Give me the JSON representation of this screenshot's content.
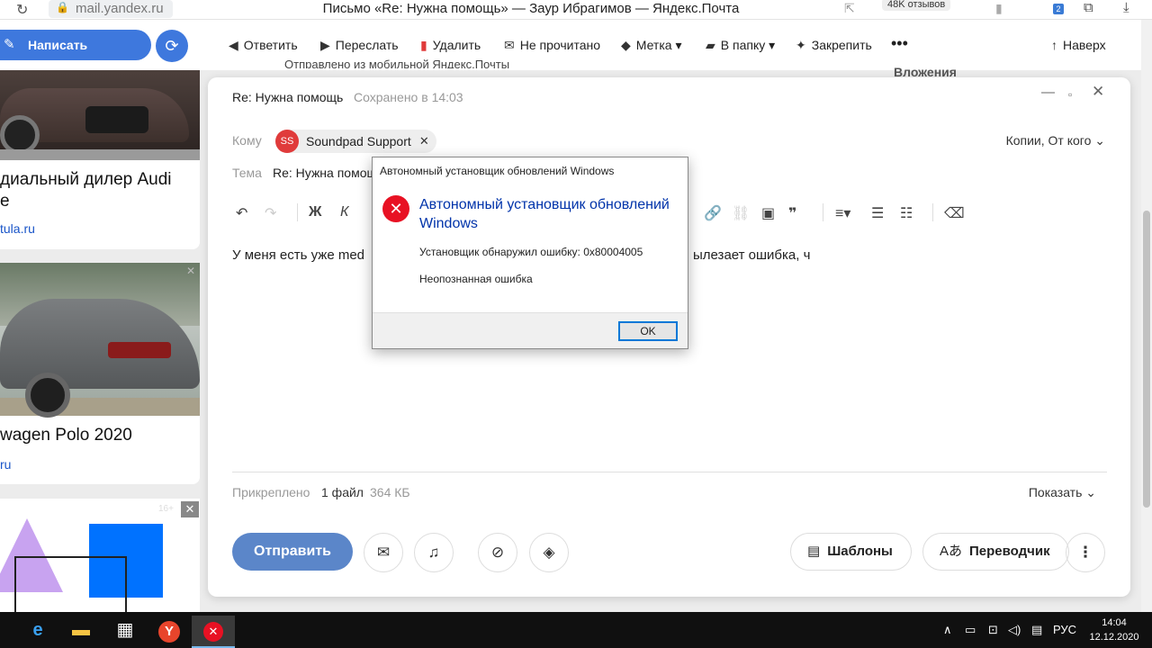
{
  "browser": {
    "url": "mail.yandex.ru",
    "window_title": "Письмо «Re: Нужна помощь» — Заур Ибрагимов — Яндекс.Почта",
    "reviews_badge": "48K отзывов",
    "ext_badge": "2"
  },
  "mailbar": {
    "compose": "Написать",
    "actions": {
      "reply": "Ответить",
      "forward": "Переслать",
      "delete": "Удалить",
      "unread": "Не прочитано",
      "label": "Метка",
      "folder": "В папку",
      "pin": "Закрепить",
      "up": "Наверх"
    }
  },
  "ads": {
    "ad1_title": "диальный дилер Audi",
    "ad1_title2": "е",
    "ad1_link": "tula.ru",
    "ad2_title": "wagen Polo 2020",
    "ad2_link": "ru",
    "ad3_age": "16+"
  },
  "background": {
    "prev_text": "Отправлено из мобильной Яндекс.Почты",
    "attachments_heading": "Вложения"
  },
  "composer": {
    "title": "Re: Нужна помощь",
    "saved": "Сохранено в 14:03",
    "to_label": "Кому",
    "recipient_initials": "SS",
    "recipient_name": "Soundpad Support",
    "cc_label": "Копии, От кого",
    "subject_label": "Тема",
    "subject_value": "Re: Нужна помощь",
    "body_left": "У меня есть уже med",
    "body_right": "ылезает ошибка, ч",
    "attached_label": "Прикреплено",
    "attached_count": "1 файл",
    "attached_size": "364 КБ",
    "show_label": "Показать",
    "send": "Отправить",
    "templates": "Шаблоны",
    "translator": "Переводчик"
  },
  "dialog": {
    "title": "Автономный установщик обновлений Windows",
    "heading": "Автономный установщик обновлений Windows",
    "message": "Установщик обнаружил ошибку: 0x80004005",
    "detail": "Неопознанная ошибка",
    "ok": "OK"
  },
  "taskbar": {
    "lang": "РУС",
    "time": "14:04",
    "date": "12.12.2020"
  },
  "colors": {
    "accent": "#3e78dd",
    "send": "#5b86c9",
    "error": "#e81123",
    "dialog_heading": "#0033aa"
  }
}
